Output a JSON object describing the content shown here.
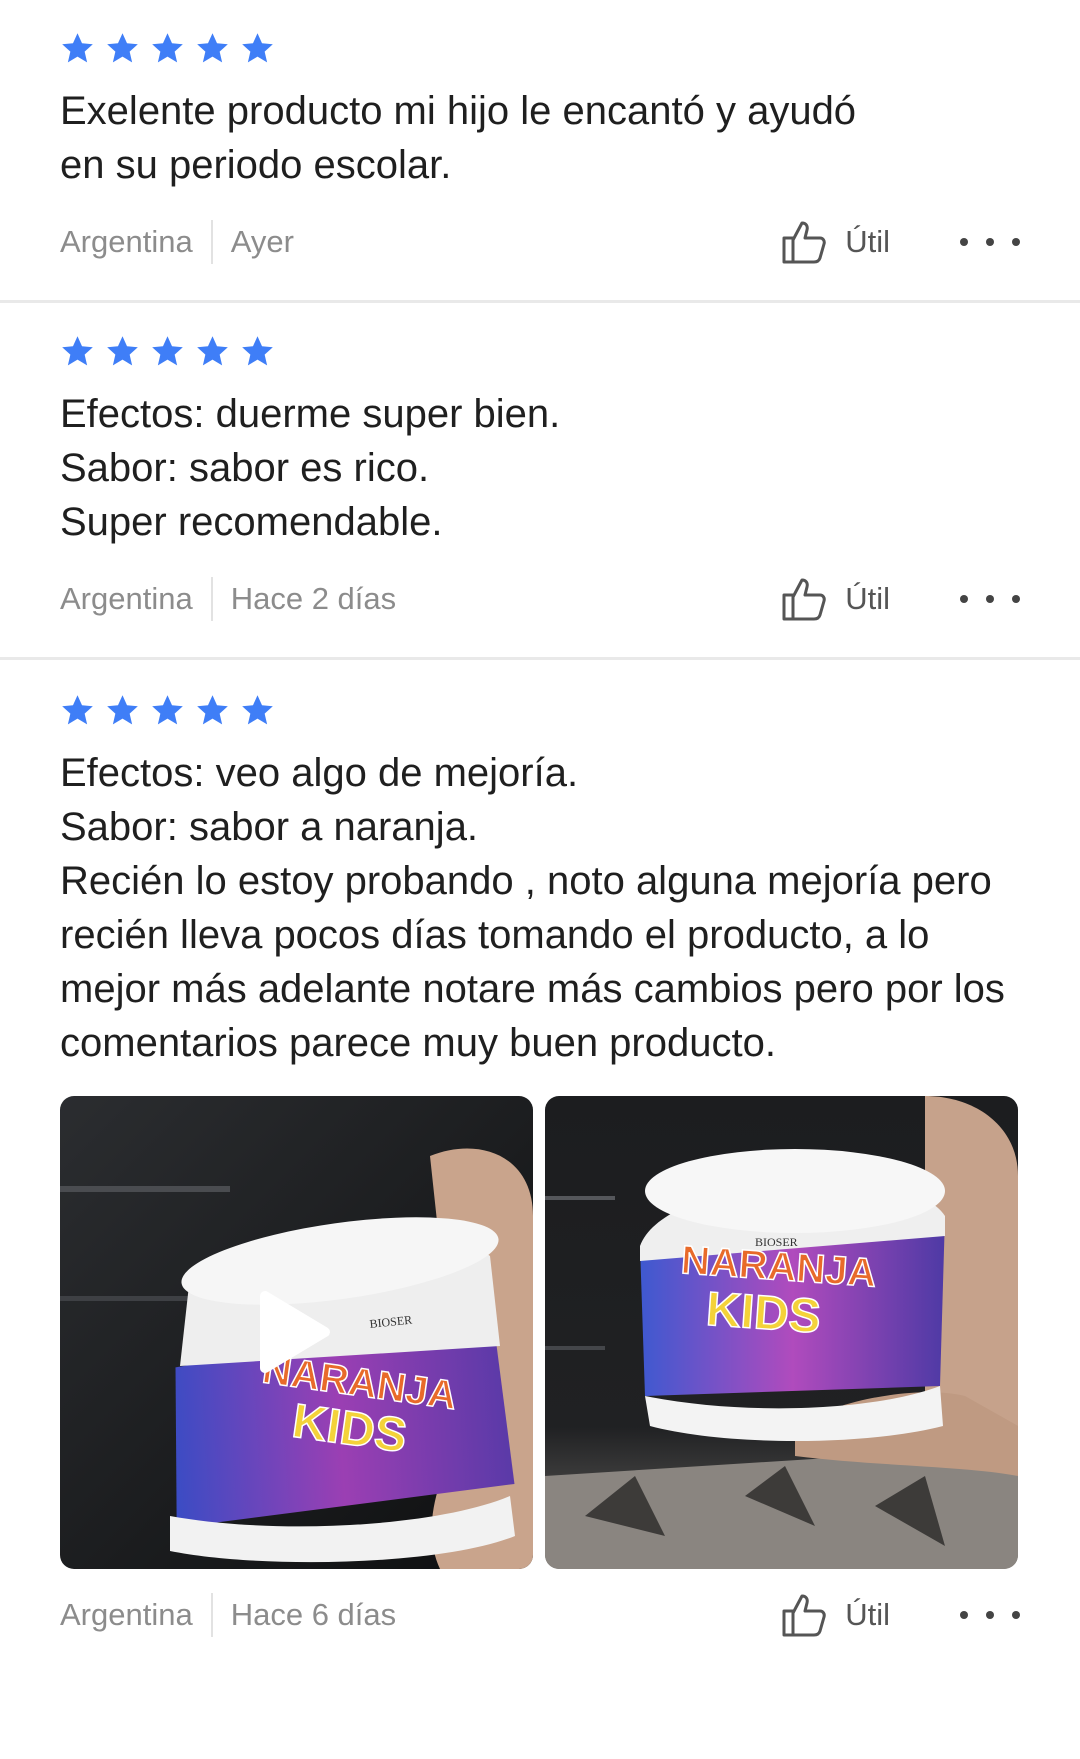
{
  "reviews": [
    {
      "rating": 5,
      "text": "Exelente producto mi hijo le encantó y ayudó en su periodo escolar.",
      "country": "Argentina",
      "date": "Ayer",
      "useful_label": "Útil"
    },
    {
      "rating": 5,
      "text": "Efectos: duerme super bien.\nSabor: sabor es rico.\nSuper recomendable.",
      "country": "Argentina",
      "date": "Hace 2 días",
      "useful_label": "Útil"
    },
    {
      "rating": 5,
      "text": "Efectos: veo algo de mejoría.\nSabor: sabor a naranja.\nRecién lo estoy probando , noto alguna mejoría pero recién lleva pocos días tomando el producto, a lo mejor más adelante notare más cambios pero por los comentarios parece muy buen producto.",
      "country": "Argentina",
      "date": "Hace 6 días",
      "useful_label": "Útil",
      "media": [
        {
          "type": "video",
          "brand": "BIOSER",
          "product_line1": "NARANJA",
          "product_line2": "KIDS"
        },
        {
          "type": "photo",
          "brand": "BIOSER",
          "product_line1": "NARANJA",
          "product_line2": "KIDS"
        }
      ]
    }
  ],
  "colors": {
    "star": "#3f7ef7",
    "meta_text": "#8c8c8c",
    "divider": "#e9e9e9"
  },
  "icons": {
    "star": "star-icon",
    "useful": "thumbs-up-icon",
    "more": "more-dots-icon",
    "play": "play-icon"
  }
}
